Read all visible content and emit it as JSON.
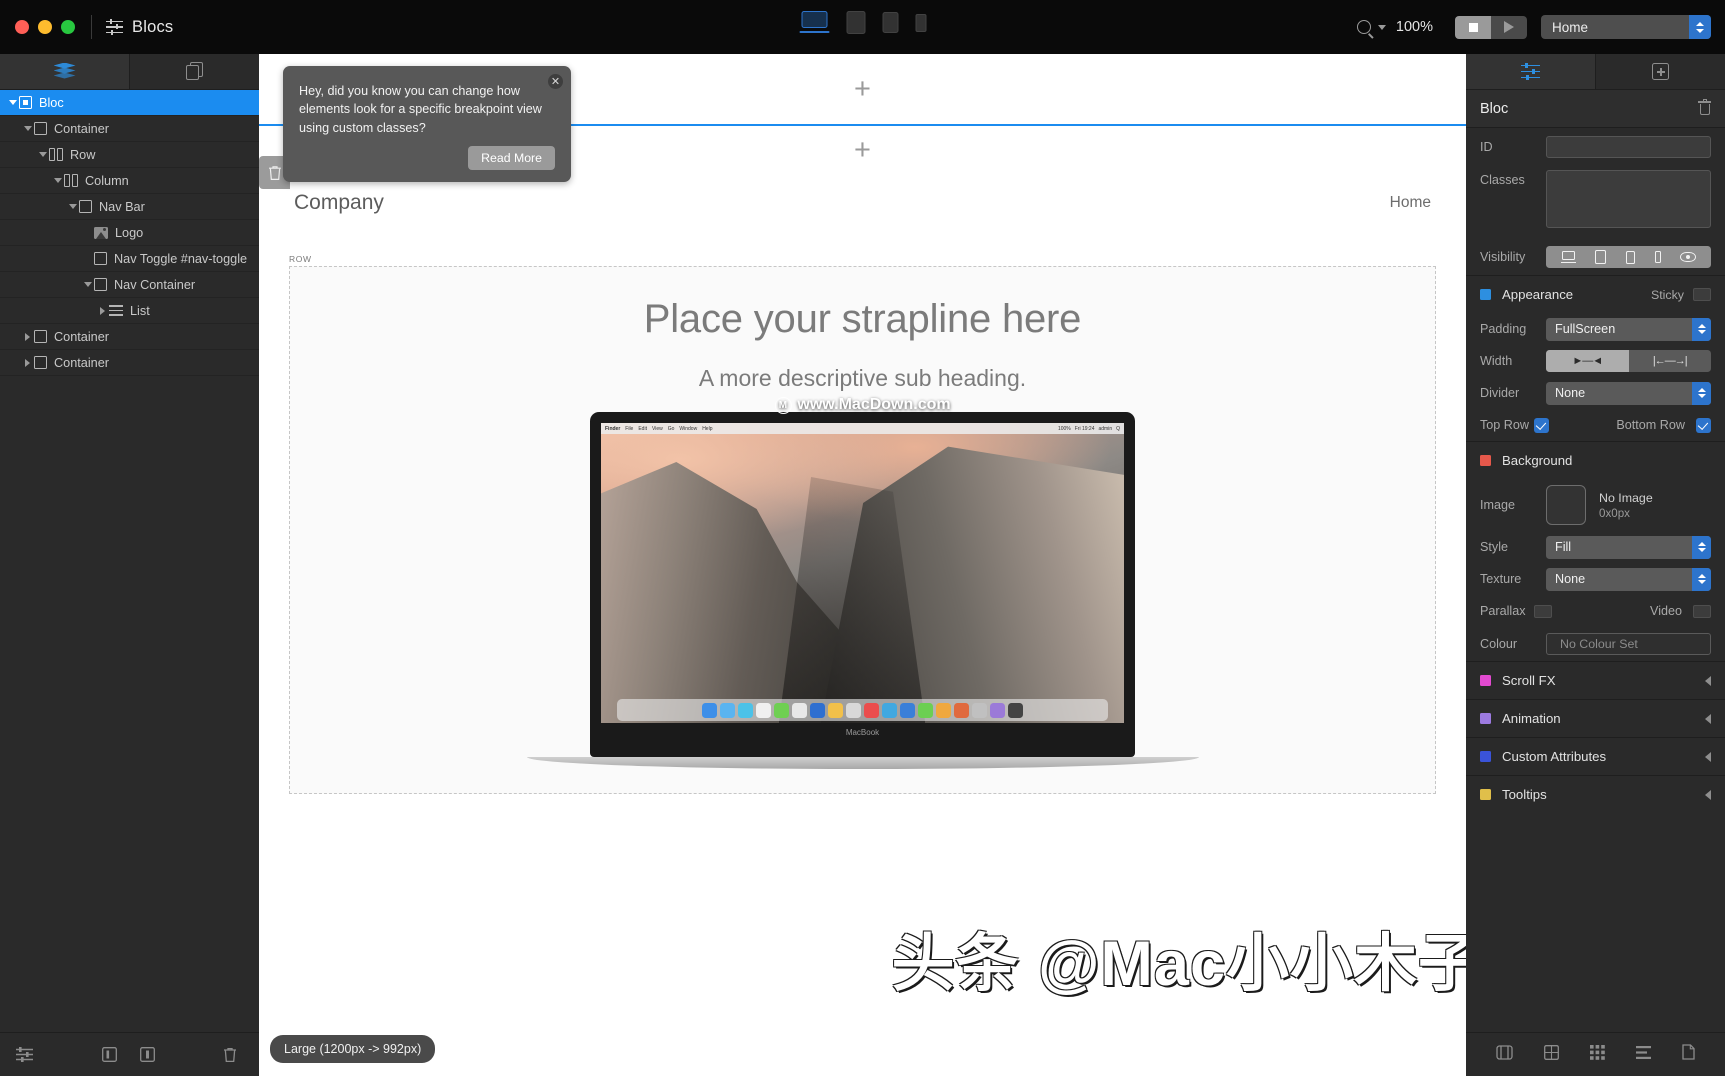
{
  "titlebar": {
    "app_title": "Blocs",
    "zoom_level": "100%",
    "page_name": "Home",
    "breakpoints": [
      {
        "name": "desktop",
        "selected": true
      },
      {
        "name": "tablet-landscape",
        "selected": false
      },
      {
        "name": "tablet-portrait",
        "selected": false
      },
      {
        "name": "phone",
        "selected": false
      }
    ]
  },
  "left_sidebar": {
    "tabs": [
      {
        "icon": "layers-icon",
        "active": true
      },
      {
        "icon": "pages-icon",
        "active": false
      }
    ],
    "tree": [
      {
        "label": "Bloc",
        "depth": 0,
        "icon": "filled-box-icon",
        "twisty": "down",
        "selected": true
      },
      {
        "label": "Container",
        "depth": 1,
        "icon": "box-icon",
        "twisty": "down",
        "selected": false
      },
      {
        "label": "Row",
        "depth": 2,
        "icon": "columns-icon",
        "twisty": "down",
        "selected": false
      },
      {
        "label": "Column",
        "depth": 3,
        "icon": "columns-icon",
        "twisty": "down",
        "selected": false
      },
      {
        "label": "Nav Bar",
        "depth": 4,
        "icon": "box-icon",
        "twisty": "down",
        "selected": false
      },
      {
        "label": "Logo",
        "depth": 5,
        "icon": "image-icon",
        "twisty": "none",
        "selected": false
      },
      {
        "label": "Nav Toggle #nav-toggle",
        "depth": 5,
        "icon": "box-icon",
        "twisty": "none",
        "selected": false
      },
      {
        "label": "Nav Container",
        "depth": 5,
        "icon": "box-icon",
        "twisty": "down",
        "selected": false
      },
      {
        "label": "List",
        "depth": 6,
        "icon": "list-icon",
        "twisty": "right",
        "selected": false
      },
      {
        "label": "Container",
        "depth": 1,
        "icon": "box-icon",
        "twisty": "right",
        "selected": false
      },
      {
        "label": "Container",
        "depth": 1,
        "icon": "box-icon",
        "twisty": "right",
        "selected": false
      }
    ],
    "bottom_icons": [
      "settings-sliders-icon",
      "split-view-icon",
      "panel-icon",
      "trash-icon"
    ]
  },
  "tooltip": {
    "message": "Hey, did you know you can change how elements look for a specific breakpoint view using custom classes?",
    "button_label": "Read More",
    "close_label": "✕"
  },
  "canvas": {
    "navbar": {
      "brand": "Company",
      "link": "Home"
    },
    "row_label": "ROW",
    "strapline": "Place your strapline here",
    "subheading": "A more descriptive sub heading.",
    "macbook_label": "MacBook",
    "mac_menubar": [
      "Finder",
      "File",
      "Edit",
      "View",
      "Go",
      "Window",
      "Help"
    ],
    "mac_menubar_right": [
      "100%",
      "Fri 19:24",
      "admin",
      "Q"
    ],
    "watermark_top": "www.MacDown.com",
    "watermark_bottom": "头条 @Mac小小木子李",
    "breakpoint_badge": "Large (1200px -> 992px)",
    "add_symbol": "+"
  },
  "right_panel": {
    "tabs": [
      {
        "icon": "sliders-icon",
        "active": true
      },
      {
        "icon": "add-box-icon",
        "active": false
      }
    ],
    "title": "Bloc",
    "delete_icon": "trash-icon",
    "fields": {
      "id_label": "ID",
      "id_value": "",
      "classes_label": "Classes",
      "classes_value": "",
      "visibility_label": "Visibility",
      "visibility_options": [
        "desktop",
        "tablet-landscape",
        "tablet-portrait",
        "phone",
        "eye"
      ]
    },
    "appearance": {
      "title": "Appearance",
      "color": "#2d8fe0",
      "sticky_label": "Sticky",
      "sticky_on": false,
      "padding_label": "Padding",
      "padding_value": "FullScreen",
      "width_label": "Width",
      "width_selected": "inset",
      "divider_label": "Divider",
      "divider_value": "None",
      "top_row_label": "Top Row",
      "top_row_checked": true,
      "bottom_row_label": "Bottom Row",
      "bottom_row_checked": true
    },
    "background": {
      "title": "Background",
      "color": "#e5584b",
      "image_label": "Image",
      "image_state": "No Image",
      "image_size": "0x0px",
      "style_label": "Style",
      "style_value": "Fill",
      "texture_label": "Texture",
      "texture_value": "None",
      "parallax_label": "Parallax",
      "parallax_on": false,
      "video_label": "Video",
      "video_on": false,
      "colour_label": "Colour",
      "colour_value": "No Colour Set"
    },
    "sections": [
      {
        "title": "Scroll FX",
        "color": "#e24ad0"
      },
      {
        "title": "Animation",
        "color": "#9c7ae0"
      },
      {
        "title": "Custom Attributes",
        "color": "#3a53d8"
      },
      {
        "title": "Tooltips",
        "color": "#e0bf4a"
      }
    ],
    "bottom_icons": [
      "component-icon",
      "grid-small-icon",
      "grid-icon",
      "list-icon",
      "page-icon"
    ]
  }
}
